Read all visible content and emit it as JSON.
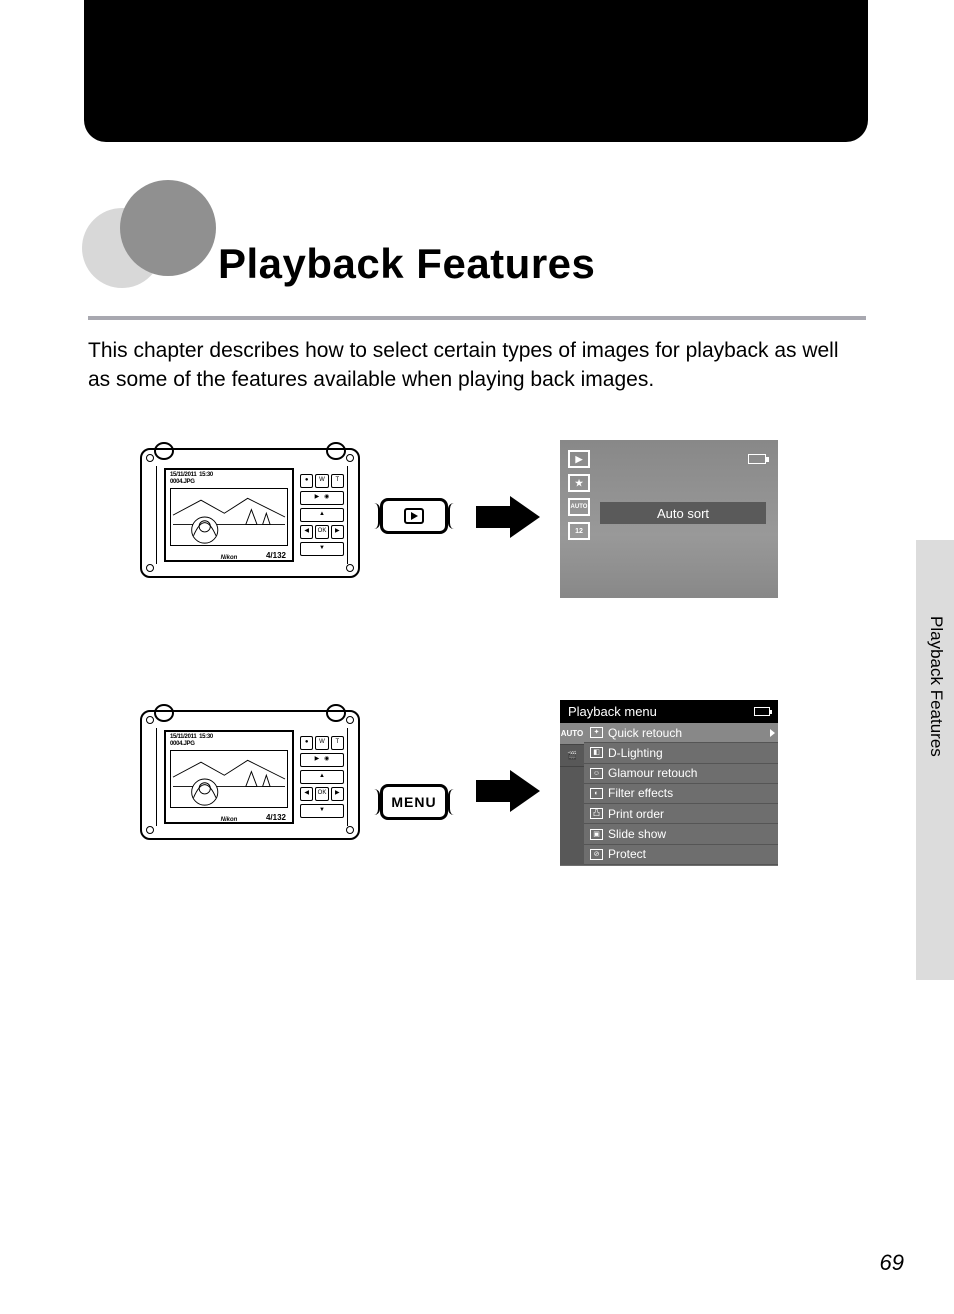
{
  "page": {
    "title": "Playback Features",
    "intro": "This chapter describes how to select certain types of images for playback as well as some of the features available when playing back images.",
    "side_label": "Playback Features",
    "number": "69"
  },
  "camera_lcd": {
    "date": "15/11/2011",
    "time": "15:30",
    "file": "0004.JPG",
    "counter": "4/132",
    "brand": "Nikon"
  },
  "popout": {
    "row1_label": "▶",
    "row2_label": "MENU"
  },
  "screen1": {
    "icons": [
      "▶",
      "★",
      "AUTO",
      "12"
    ],
    "selected": "Auto sort"
  },
  "screen2": {
    "title": "Playback menu",
    "tabs": [
      "AUTO",
      ""
    ],
    "items": [
      "Quick retouch",
      "D-Lighting",
      "Glamour retouch",
      "Filter effects",
      "Print order",
      "Slide show",
      "Protect"
    ]
  }
}
